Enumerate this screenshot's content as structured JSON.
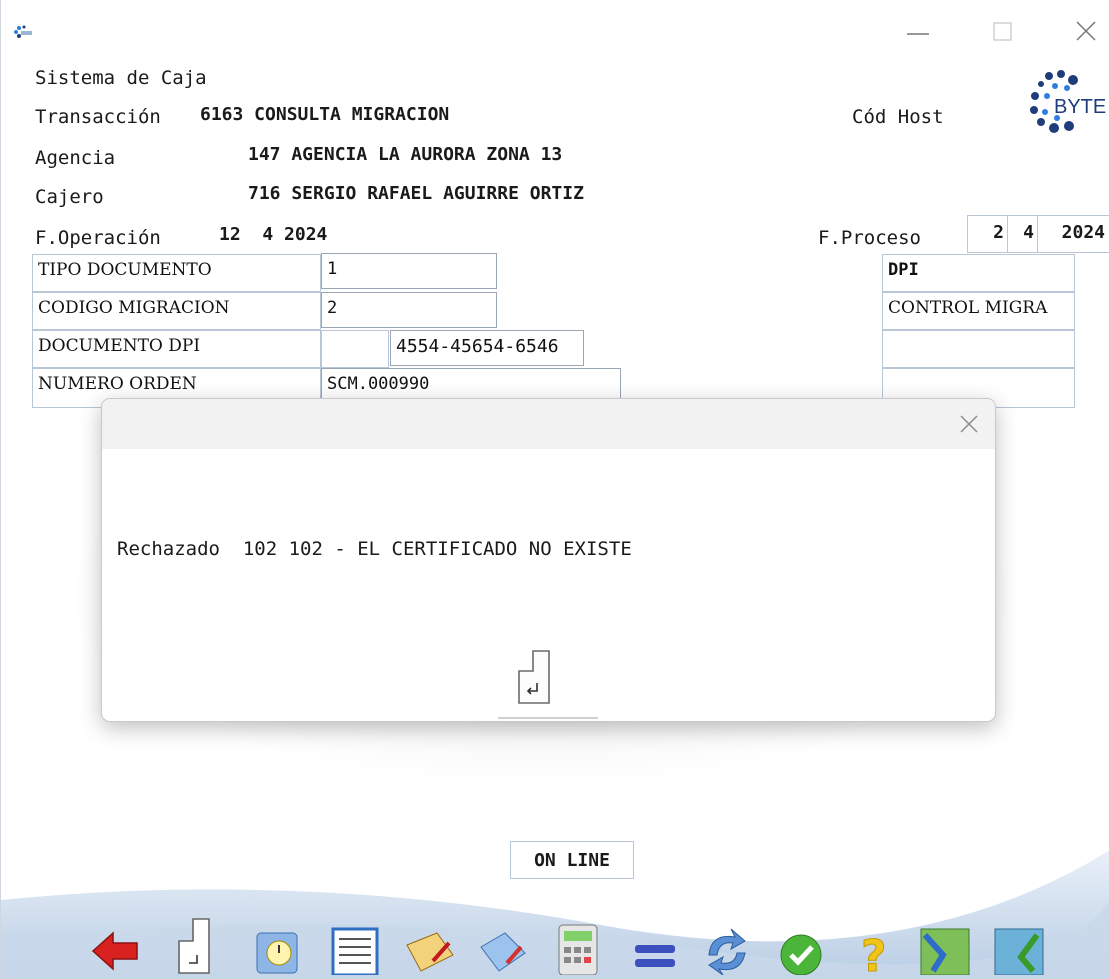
{
  "window": {
    "minimize": "—",
    "maximize": "☐",
    "close": "✕"
  },
  "header": {
    "system": "Sistema de Caja",
    "transaccion_label": "Transacción",
    "transaccion_value": "6163 CONSULTA MIGRACION",
    "cod_host_label": "Cód Host",
    "agencia_label": "Agencia",
    "agencia_value": "147 AGENCIA LA AURORA ZONA 13",
    "cajero_label": "Cajero",
    "cajero_value": "716 SERGIO RAFAEL AGUIRRE ORTIZ",
    "f_operacion_label": "F.Operación",
    "f_operacion_value": "12  4 2024",
    "f_proceso_label": "F.Proceso",
    "f_proceso_day": "2",
    "f_proceso_month": "4",
    "f_proceso_year": "2024"
  },
  "logo": {
    "text": "BYTE",
    "colors": {
      "dark": "#1f3d7a",
      "accent": "#2f7de1"
    }
  },
  "form": {
    "rows": [
      {
        "label": "TIPO DOCUMENTO",
        "value": "1",
        "desc": "DPI"
      },
      {
        "label": "CODIGO MIGRACION",
        "value": "2",
        "desc": "CONTROL MIGRA"
      },
      {
        "label": "DOCUMENTO DPI",
        "value": "4554-45654-6546",
        "desc": ""
      },
      {
        "label": "NUMERO ORDEN",
        "value": "SCM.000990",
        "desc": ""
      }
    ]
  },
  "modal": {
    "close": "✕",
    "message": "Rechazado  102 102 - EL CERTIFICADO NO EXISTE",
    "ok_icon": "enter-return-icon"
  },
  "status": {
    "text": "ON LINE"
  },
  "toolbar": {
    "icons": [
      "back-arrow-icon",
      "enter-icon",
      "calendar-clock-icon",
      "document-list-icon",
      "sign-document-icon",
      "edit-document-icon",
      "calculator-icon",
      "equals-icon",
      "refresh-icon",
      "check-icon",
      "help-icon",
      "map-transfer-icon",
      "map-transfer-2-icon"
    ]
  }
}
